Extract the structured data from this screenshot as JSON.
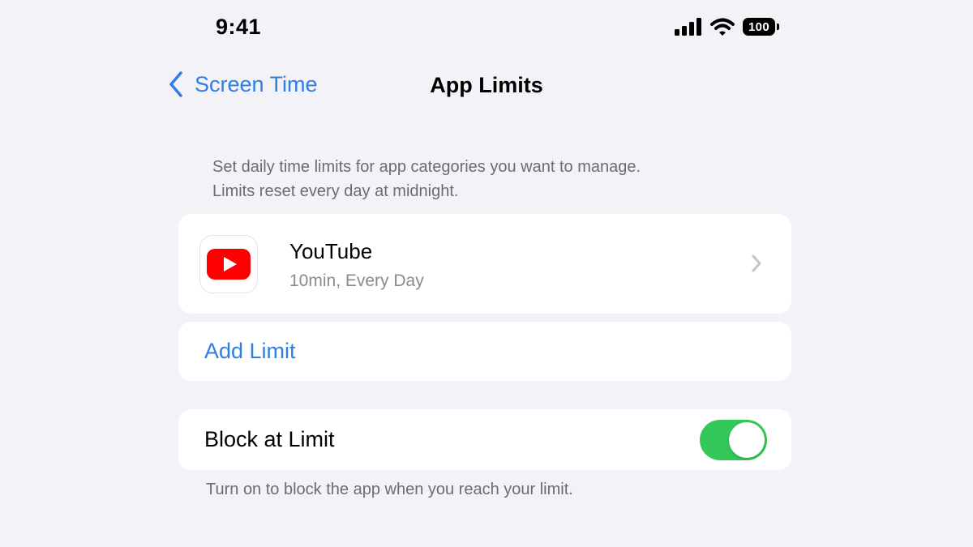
{
  "status_bar": {
    "time": "9:41",
    "battery": "100",
    "icons": [
      "signal-icon",
      "wifi-icon",
      "battery-icon"
    ]
  },
  "nav": {
    "back_label": "Screen Time",
    "title": "App Limits"
  },
  "description": {
    "line1": "Set daily time limits for app categories you want to manage.",
    "line2": "Limits reset every day at midnight."
  },
  "app_limit": {
    "app_name": "YouTube",
    "detail": "10min, Every Day",
    "icon": "youtube-icon"
  },
  "add_limit": {
    "label": "Add Limit"
  },
  "block_at_limit": {
    "label": "Block at Limit",
    "enabled": true,
    "footer": "Turn on to block the app when you reach your limit."
  },
  "colors": {
    "accent": "#2f7de6",
    "toggle_on": "#34c759",
    "background": "#f2f2f7",
    "youtube_red": "#ff0000"
  }
}
